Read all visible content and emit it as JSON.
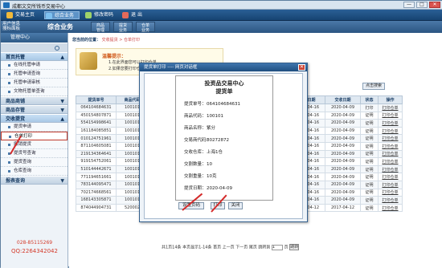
{
  "window": {
    "title": "成都文交所钱币交易中心",
    "min": "—",
    "max": "□",
    "close": "✕"
  },
  "menubar": {
    "items": [
      "交易主页",
      "综合业务",
      "修改密码",
      "退",
      "出"
    ]
  },
  "navbar": {
    "user_line1": "用户信息",
    "user_line2": "搜标面板",
    "group_title": "综合业务",
    "buttons": [
      {
        "l1": "商品",
        "l2": "管理"
      },
      {
        "l1": "提货",
        "l2": "业务"
      },
      {
        "l1": "仓单",
        "l2": "业务"
      }
    ]
  },
  "sidebar": {
    "title": "管理中心",
    "sections": [
      {
        "label": "首页托管",
        "open": true,
        "items": [
          "在线托管申请",
          "托管申请查询",
          "托管申请审核",
          "文物托管单查询"
        ]
      },
      {
        "label": "商品商铺",
        "open": false,
        "items": []
      },
      {
        "label": "商品存管",
        "open": false,
        "items": []
      },
      {
        "label": "交收提货",
        "open": true,
        "items": [
          "提货申请",
          "仓单打印",
          "撤销提货",
          "提货号查询",
          "提货查询",
          "仓库查询"
        ]
      },
      {
        "label": "报表查询",
        "open": false,
        "items": []
      }
    ],
    "selected_item": "仓单打印",
    "phone": "028-85115269",
    "qq": "QQ:2264342042"
  },
  "main": {
    "crumb_label": "您当前的位置：",
    "crumb_path": "交收提货 > 仓单打印",
    "notice_title": "温馨提示：",
    "notice_line1": "1.在此界面您可以打印仓单",
    "notice_line2": "2.如果您要打印仓单",
    "search_button": "点击搜索",
    "table": {
      "headers": [
        "提货单号",
        "商品代码",
        "",
        "",
        "",
        "",
        "",
        "",
        "",
        "",
        "仓库日期",
        "交收日期",
        "状态",
        "操作"
      ],
      "rows": [
        [
          "064104684631",
          "100101",
          "",
          "",
          "",
          "",
          "",
          "",
          "",
          "",
          "2018-04-16",
          "2020-04-09",
          "打印",
          "打印仓单"
        ],
        [
          "450154807871",
          "100101",
          "",
          "",
          "",
          "",
          "",
          "",
          "",
          "",
          "2018-04-16",
          "2020-04-09",
          "证明",
          "打印仓单"
        ],
        [
          "554154998641",
          "100101",
          "",
          "",
          "",
          "",
          "",
          "",
          "",
          "",
          "2018-04-16",
          "2020-04-09",
          "证明",
          "打印仓单"
        ],
        [
          "161184085851",
          "100101",
          "",
          "",
          "",
          "",
          "",
          "",
          "",
          "",
          "2018-04-16",
          "2020-04-09",
          "证明",
          "打印仓单"
        ],
        [
          "010124751961",
          "100101",
          "",
          "",
          "",
          "",
          "",
          "",
          "",
          "",
          "2018-04-16",
          "2020-04-09",
          "证明",
          "打印仓单"
        ],
        [
          "871104605081",
          "100101",
          "",
          "",
          "",
          "",
          "",
          "",
          "",
          "",
          "2018-04-16",
          "2020-04-09",
          "证明",
          "打印仓单"
        ],
        [
          "219134364641",
          "100101",
          "",
          "",
          "",
          "",
          "",
          "",
          "",
          "",
          "2018-04-16",
          "2020-04-09",
          "证明",
          "打印仓单"
        ],
        [
          "919154752061",
          "100101",
          "",
          "",
          "",
          "",
          "",
          "",
          "",
          "",
          "2018-04-16",
          "2020-04-09",
          "证明",
          "打印仓单"
        ],
        [
          "510144442671",
          "100101",
          "",
          "",
          "",
          "",
          "",
          "",
          "",
          "",
          "2018-04-16",
          "2020-04-09",
          "证明",
          "打印仓单"
        ],
        [
          "771194651661",
          "100101",
          "",
          "",
          "",
          "",
          "",
          "",
          "",
          "",
          "2018-04-16",
          "2020-04-09",
          "证明",
          "打印仓单"
        ],
        [
          "783144095471",
          "100101",
          "",
          "",
          "",
          "",
          "",
          "",
          "",
          "",
          "2018-04-16",
          "2020-04-09",
          "证明",
          "打印仓单"
        ],
        [
          "702174668561",
          "100101",
          "",
          "",
          "",
          "",
          "",
          "",
          "",
          "",
          "2018-04-16",
          "2020-04-09",
          "证明",
          "打印仓单"
        ],
        [
          "168143305871",
          "100101",
          "",
          "",
          "",
          "",
          "",
          "",
          "",
          "",
          "2018-04-16",
          "2020-04-09",
          "证明",
          "打印仓单"
        ],
        [
          "874044904731",
          "520002",
          "",
          "",
          "",
          "",
          "",
          "",
          "",
          "",
          "2017-04-12",
          "2017-04-12",
          "证明",
          "打印仓单"
        ]
      ]
    },
    "pager": {
      "text": "共1页14条 本页显示1-14条 首页 上一页 下一页 尾页 跳转到",
      "input": "1",
      "unit": "页",
      "go": "跳转"
    }
  },
  "modal": {
    "title": "提货单打印 ---- 网页对话框",
    "close": "✕",
    "org": "投资品交易中心",
    "doc": "提货单",
    "fields": [
      {
        "k": "提货单号：",
        "v": "064104684631"
      },
      {
        "k": "商品代码：",
        "v": "100101"
      },
      {
        "k": "商品名称：",
        "v": "紫分"
      },
      {
        "k": "交易商代码：",
        "v": "80272872"
      },
      {
        "k": "交收仓库：",
        "v": "上海1仓"
      },
      {
        "k": "交割数量：",
        "v": "10"
      },
      {
        "k": "交割重量：",
        "v": "10克"
      },
      {
        "k": "提货日期：",
        "v": "2020-04-09"
      }
    ],
    "buttons": {
      "setup": "设置页码",
      "print": "打印",
      "close": "关闭"
    }
  }
}
